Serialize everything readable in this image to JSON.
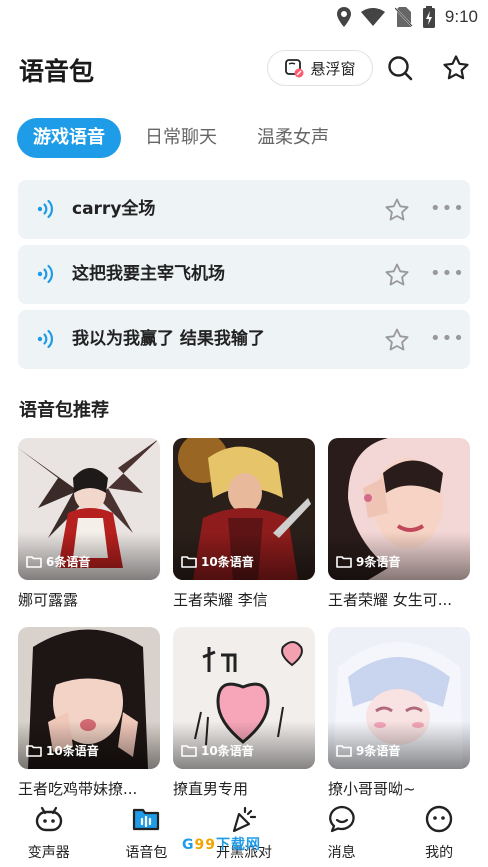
{
  "status_bar": {
    "time": "9:10"
  },
  "header": {
    "title": "语音包",
    "float_button_label": "悬浮窗"
  },
  "tabs": [
    {
      "label": "游戏语音",
      "active": true
    },
    {
      "label": "日常聊天",
      "active": false
    },
    {
      "label": "温柔女声",
      "active": false
    }
  ],
  "voices": [
    {
      "text": "carry全场"
    },
    {
      "text": "这把我要主宰飞机场"
    },
    {
      "text": "我以为我赢了 结果我输了"
    }
  ],
  "recommend": {
    "title": "语音包推荐",
    "cards": [
      {
        "title": "娜可露露",
        "count": "6条语音"
      },
      {
        "title": "王者荣耀 李信",
        "count": "10条语音"
      },
      {
        "title": "王者荣耀 女生可...",
        "count": "9条语音"
      },
      {
        "title": "王者吃鸡带妹撩...",
        "count": "10条语音"
      },
      {
        "title": "撩直男专用",
        "count": "10条语音"
      },
      {
        "title": "撩小哥哥呦~",
        "count": "9条语音"
      }
    ]
  },
  "bottom_nav": [
    {
      "label": "变声器",
      "icon": "robot-face-icon"
    },
    {
      "label": "语音包",
      "icon": "voice-pack-icon",
      "active": true
    },
    {
      "label": "开黑派对",
      "icon": "party-popper-icon"
    },
    {
      "label": "消息",
      "icon": "message-bubble-icon"
    },
    {
      "label": "我的",
      "icon": "profile-face-icon"
    }
  ],
  "watermark": {
    "prefix": "G",
    "highlight": "99",
    "suffix": "下载网"
  },
  "colors": {
    "accent": "#1e9ce8",
    "item_bg": "#eef3f6"
  }
}
